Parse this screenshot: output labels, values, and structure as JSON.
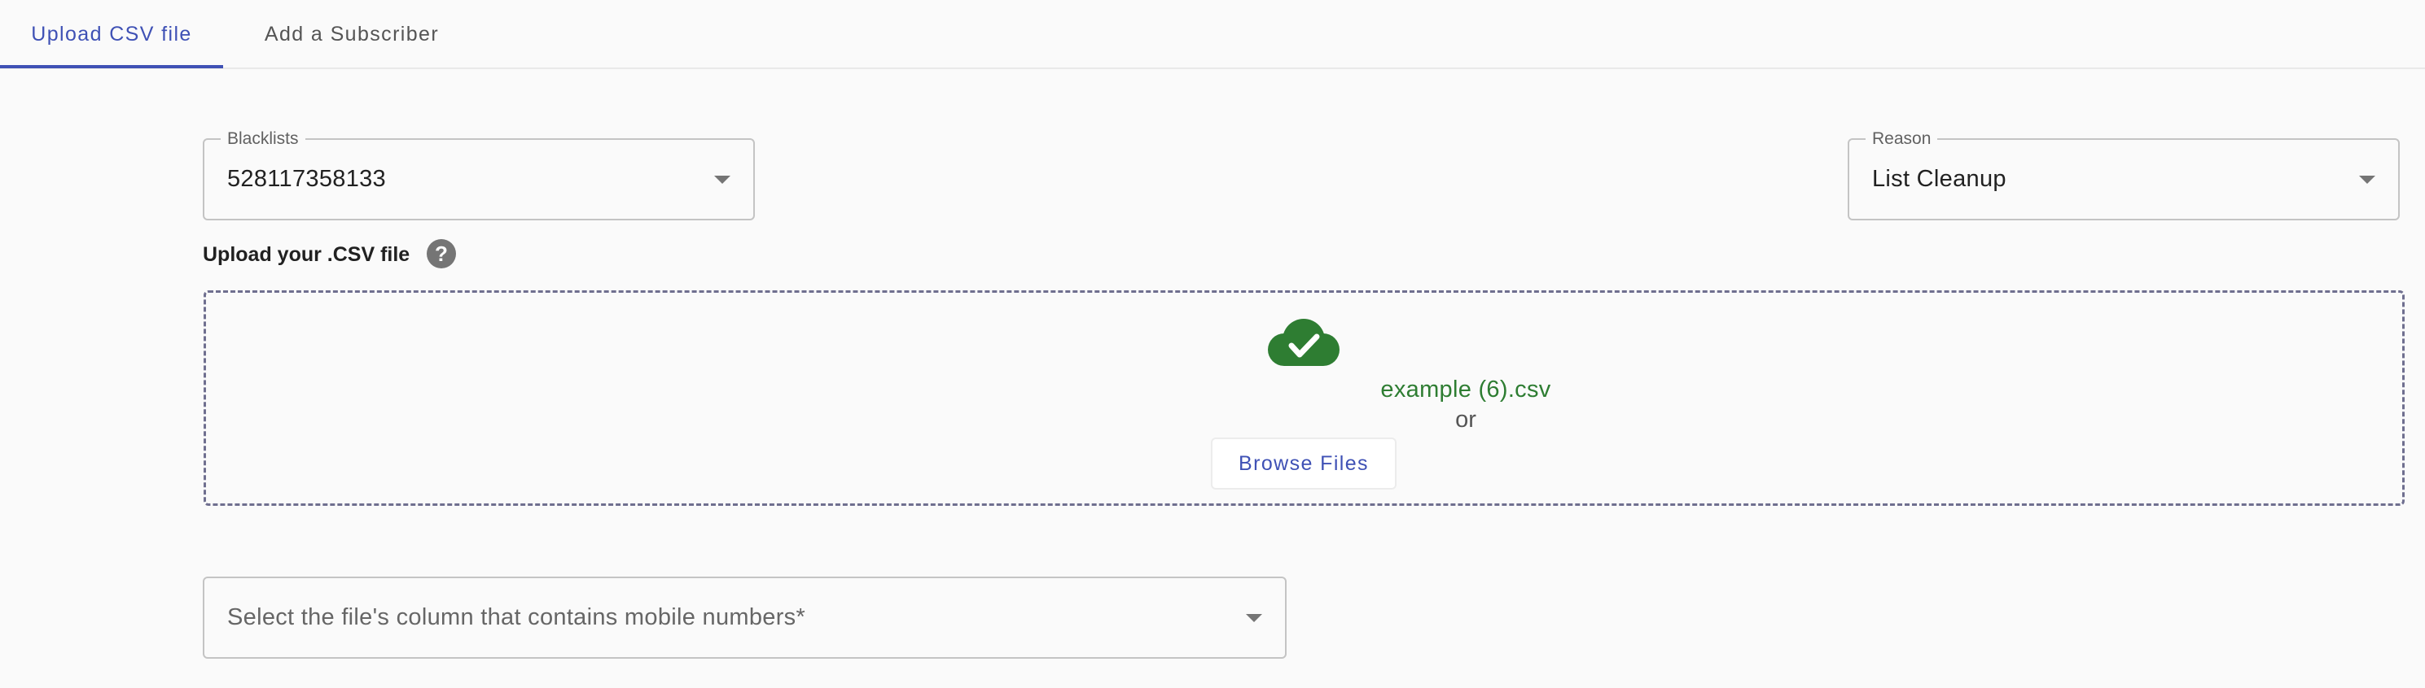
{
  "tabs": [
    {
      "label": "Upload CSV file",
      "active": true
    },
    {
      "label": "Add a Subscriber",
      "active": false
    }
  ],
  "blacklists": {
    "label": "Blacklists",
    "value": "528117358133"
  },
  "reason": {
    "label": "Reason",
    "value": "List Cleanup"
  },
  "upload": {
    "heading": "Upload your .CSV file",
    "help_icon": "?",
    "file_name": "example (6).csv",
    "or_text": "or",
    "browse_label": "Browse Files"
  },
  "column_select": {
    "placeholder": "Select the file's column that contains mobile numbers*"
  },
  "colors": {
    "accent": "#3f51b5",
    "success": "#2e7d32"
  },
  "icons": {
    "upload_status": "cloud-check-icon",
    "help": "help-circle-icon",
    "dropdown": "chevron-down-icon"
  }
}
